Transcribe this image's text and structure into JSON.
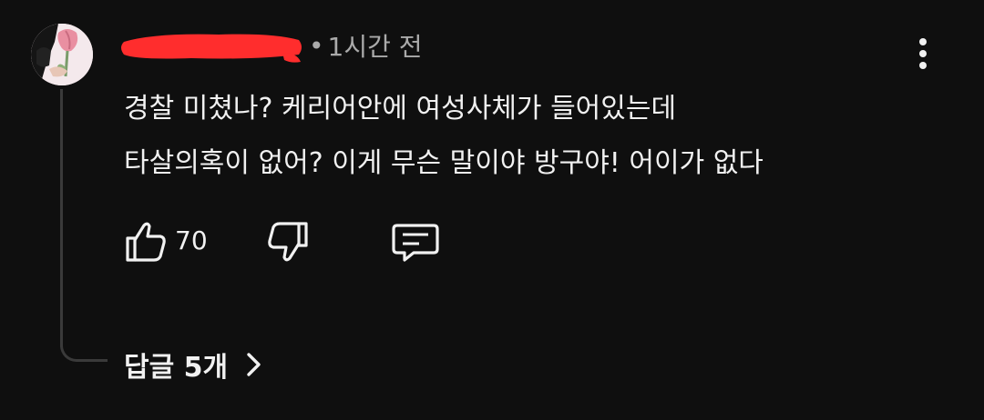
{
  "comment": {
    "author_redacted": true,
    "separator": "•",
    "timestamp": "1시간 전",
    "text_lines": [
      "경찰 미쳤나? 케리어안에 여성사체가 들어있는데",
      "타살의혹이 없어? 이게 무슨 말이야 방구야! 어이가 없다"
    ],
    "like_count": "70",
    "replies_label": "답글 5개"
  },
  "icons": {
    "avatar": "tulip-avatar",
    "more": "more-vert-icon",
    "like": "thumb-up-icon",
    "dislike": "thumb-down-icon",
    "reply": "comment-reply-icon",
    "chevron": "chevron-right-icon"
  },
  "colors": {
    "background": "#0f0f0f",
    "text": "#f1f1f1",
    "meta": "#aaaaaa",
    "redaction": "#ff2d2d"
  }
}
